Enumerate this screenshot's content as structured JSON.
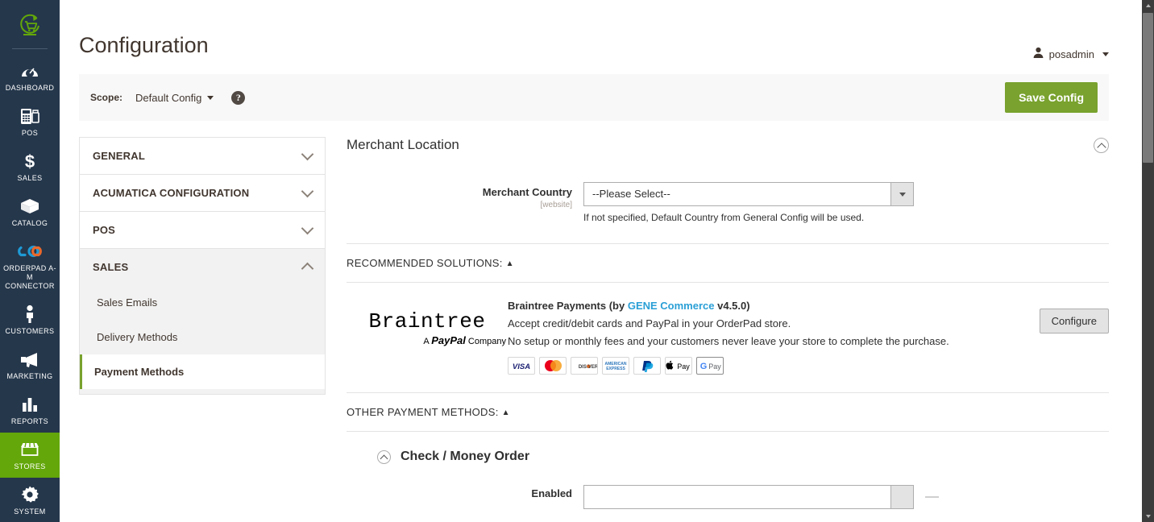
{
  "leftnav": {
    "logo_icon": "orderpad-cart-logo-icon",
    "items": [
      {
        "label": "DASHBOARD",
        "icon": "dashboard-gauge-icon",
        "active": false
      },
      {
        "label": "POS",
        "icon": "pos-terminal-icon",
        "active": false
      },
      {
        "label": "SALES",
        "icon": "dollar-sign-icon",
        "active": false
      },
      {
        "label": "CATALOG",
        "icon": "box-icon",
        "active": false
      },
      {
        "label": "ORDERPAD A-M CONNECTOR",
        "icon": "link-chain-icon",
        "active": false
      },
      {
        "label": "CUSTOMERS",
        "icon": "person-icon",
        "active": false
      },
      {
        "label": "MARKETING",
        "icon": "megaphone-icon",
        "active": false
      },
      {
        "label": "REPORTS",
        "icon": "bar-chart-icon",
        "active": false
      },
      {
        "label": "STORES",
        "icon": "storefront-icon",
        "active": true
      },
      {
        "label": "SYSTEM",
        "icon": "gear-icon",
        "active": false
      }
    ]
  },
  "header": {
    "title": "Configuration",
    "user": {
      "name": "posadmin",
      "icon": "user-avatar-icon"
    }
  },
  "actions_bar": {
    "scope_label": "Scope:",
    "scope_value": "Default Config",
    "help_icon_text": "?",
    "save_label": "Save Config"
  },
  "config_nav": {
    "sections": [
      {
        "label": "GENERAL",
        "open": false
      },
      {
        "label": "ACUMATICA CONFIGURATION",
        "open": false
      },
      {
        "label": "POS",
        "open": false
      },
      {
        "label": "SALES",
        "open": true
      }
    ],
    "sales_items": [
      {
        "label": "Sales Emails",
        "current": false
      },
      {
        "label": "Delivery Methods",
        "current": false
      },
      {
        "label": "Payment Methods",
        "current": true
      }
    ]
  },
  "merchant_location": {
    "fieldset_title": "Merchant Location",
    "country": {
      "label": "Merchant Country",
      "scope": "[website]",
      "value": "--Please Select--",
      "note": "If not specified, Default Country from General Config will be used."
    }
  },
  "recommended": {
    "heading": "RECOMMENDED SOLUTIONS:",
    "triangle": "▲",
    "braintree": {
      "logo_word": "Braintree",
      "logo_sub_prefix": "A ",
      "logo_sub_brand": "PayPal",
      "logo_sub_suffix": " Company",
      "title_pre": "Braintree Payments (by ",
      "title_link": "GENE Commerce",
      "title_post": " v4.5.0)",
      "desc_line1": "Accept credit/debit cards and PayPal in your OrderPad store.",
      "desc_line2": "No setup or monthly fees and your customers never leave your store to complete the purchase.",
      "cards": [
        {
          "name": "visa-card-icon",
          "text": "VISA"
        },
        {
          "name": "mastercard-card-icon",
          "text": ""
        },
        {
          "name": "discover-card-icon",
          "text": "DISC❖VER"
        },
        {
          "name": "amex-card-icon",
          "text": "AMERICAN EXPRESS"
        },
        {
          "name": "paypal-card-icon",
          "text": ""
        },
        {
          "name": "apple-pay-icon",
          "text": "Pay"
        },
        {
          "name": "google-pay-icon",
          "text": "Pay"
        }
      ],
      "configure_label": "Configure"
    }
  },
  "other_methods": {
    "heading": "OTHER PAYMENT METHODS:",
    "triangle": "▲",
    "check_money_order": {
      "title": "Check / Money Order",
      "enabled_label": "Enabled"
    }
  },
  "colors": {
    "nav_bg": "#25374b",
    "accent_green": "#79a22e",
    "active_green": "#63a70a",
    "link_blue": "#2a9fd6",
    "text_dark": "#303030",
    "title_brown": "#41362f"
  }
}
